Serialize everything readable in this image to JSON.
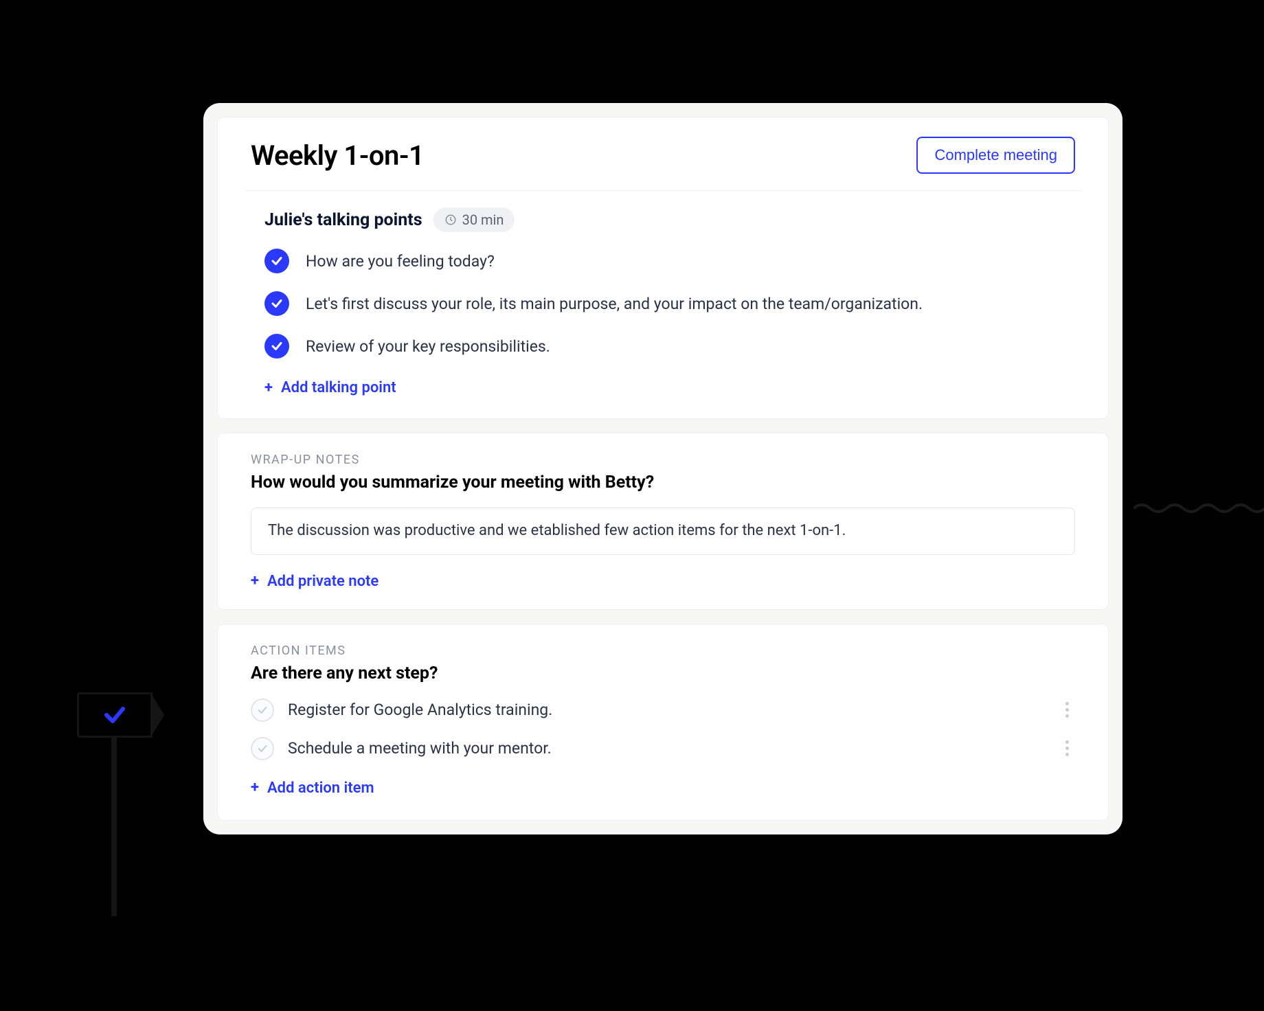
{
  "colors": {
    "accent": "#2b39ff"
  },
  "header": {
    "title": "Weekly 1-on-1",
    "complete_label": "Complete meeting"
  },
  "talking_points": {
    "title": "Julie's talking points",
    "duration": "30 min",
    "items": [
      {
        "text": "How are you feeling today?",
        "checked": true
      },
      {
        "text": "Let's first discuss your role, its main purpose, and your impact on the team/organization.",
        "checked": true
      },
      {
        "text": "Review of your key responsibilities.",
        "checked": true
      }
    ],
    "add_label": "Add talking point"
  },
  "wrapup": {
    "eyebrow": "WRAP-UP NOTES",
    "question": "How would you summarize your meeting with Betty?",
    "note_value": "The discussion was productive and we etablished few action items for the next 1-on-1.",
    "add_label": "Add private note"
  },
  "action_items": {
    "eyebrow": "ACTION ITEMS",
    "question": "Are there any next step?",
    "items": [
      {
        "text": "Register for Google Analytics training.",
        "checked": false
      },
      {
        "text": "Schedule a meeting with your mentor.",
        "checked": false
      }
    ],
    "add_label": "Add action item"
  }
}
